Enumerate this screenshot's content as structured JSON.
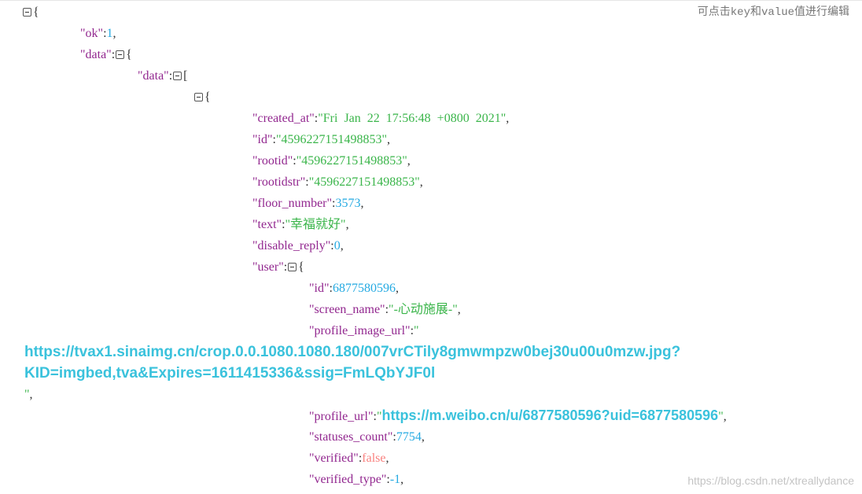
{
  "hint": "可点击key和value值进行编辑",
  "watermark": "https://blog.csdn.net/xtreallydance",
  "brace_open": "{",
  "bracket_open": "[",
  "lines": {
    "ok": {
      "key": "\"ok\"",
      "value": "1"
    },
    "data1": {
      "key": "\"data\""
    },
    "data2": {
      "key": "\"data\""
    },
    "created_at": {
      "key": "\"created_at\"",
      "value": "\"Fri  Jan  22  17:56:48  +0800  2021\""
    },
    "id": {
      "key": "\"id\"",
      "value": "\"4596227151498853\""
    },
    "rootid": {
      "key": "\"rootid\"",
      "value": "\"4596227151498853\""
    },
    "rootidstr": {
      "key": "\"rootidstr\"",
      "value": "\"4596227151498853\""
    },
    "floor_number": {
      "key": "\"floor_number\"",
      "value": "3573"
    },
    "text": {
      "key": "\"text\"",
      "value": "\"幸福就好\""
    },
    "disable_reply": {
      "key": "\"disable_reply\"",
      "value": "0"
    },
    "user": {
      "key": "\"user\""
    },
    "user_id": {
      "key": "\"id\"",
      "value": "6877580596"
    },
    "screen_name": {
      "key": "\"screen_name\"",
      "value": "\"-心动施展-\""
    },
    "profile_image_url": {
      "key": "\"profile_image_url\"",
      "value_open": "\"",
      "value_line1": "https://tvax1.sinaimg.cn/crop.0.0.1080.1080.180/007vrCTily8gmwmpzw0bej30u00u0mzw.jpg?",
      "value_line2": "KID=imgbed,tva&Expires=1611415336&ssig=FmLQbYJF0l",
      "value_close": "\""
    },
    "profile_url": {
      "key": "\"profile_url\"",
      "value_url": "https://m.weibo.cn/u/6877580596?uid=6877580596"
    },
    "statuses_count": {
      "key": "\"statuses_count\"",
      "value": "7754"
    },
    "verified": {
      "key": "\"verified\"",
      "value": "false"
    },
    "verified_type": {
      "key": "\"verified_type\"",
      "value": "-1"
    }
  }
}
